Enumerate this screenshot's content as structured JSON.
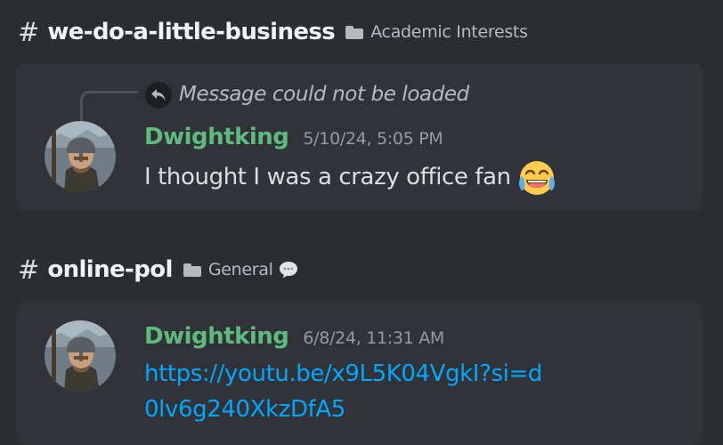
{
  "channels": [
    {
      "hash": "#",
      "name": "we-do-a-little-business",
      "category": "Academic Interests",
      "message": {
        "reply_text": "Message could not be loaded",
        "author": "Dwightking",
        "timestamp": "5/10/24, 5:05 PM",
        "text": "I thought I was a crazy office fan",
        "emoji": "joy-emoji"
      }
    },
    {
      "hash": "#",
      "name": "online-pol",
      "category": "General",
      "category_icon": "speech-bubble-icon",
      "message": {
        "author": "Dwightking",
        "timestamp": "6/8/24, 11:31 AM",
        "link": "https://youtu.be/x9L5K04VgkI?si=d0lv6g240XkzDfA5"
      }
    }
  ],
  "colors": {
    "background": "#2b2d31",
    "card": "#313338",
    "username": "#5fba7d",
    "link": "#00a8fc",
    "muted": "#949ba4"
  }
}
